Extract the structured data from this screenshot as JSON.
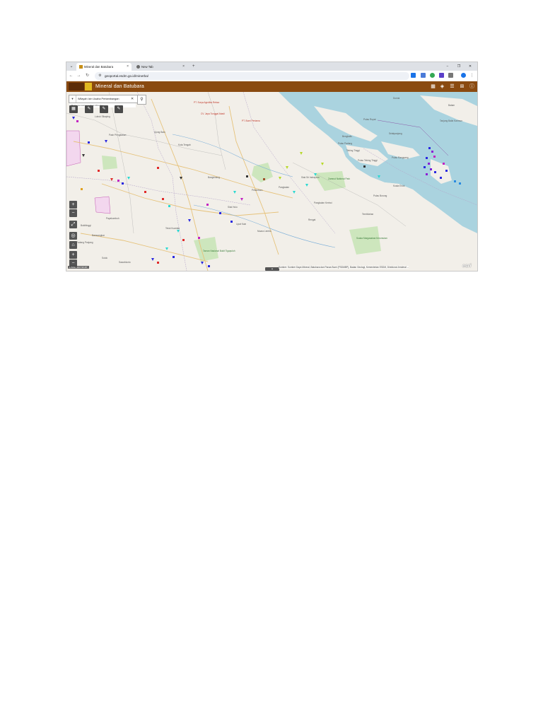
{
  "browser": {
    "tabs": [
      {
        "title": "Mineral dan Batubara"
      },
      {
        "title": "New Tab"
      }
    ],
    "new_tab_label": "+",
    "close_label": "×",
    "window_controls": {
      "minimize": "−",
      "restore": "❐",
      "close": "✕"
    },
    "url": "geoportal.esdm.go.id/minerba/"
  },
  "app": {
    "title": "Mineral dan Batubara",
    "header_icons": [
      "basemap-icon",
      "layers-icon",
      "legend-icon",
      "add-icon",
      "info-icon"
    ],
    "accent_color": "#8a4a10"
  },
  "search": {
    "value": "Wilayah Izin Usaha Pertambangan",
    "hint": "Batas pencarian terluas Minerba"
  },
  "map": {
    "coords": "1°6'51\" 101°34'45\"",
    "attribution": "Sumber: Sumber Daya Mineral, Batubara dan Panas Bumi (PSDMBP), Badan Geologi, Kementerian ESDM, Direktorat Jenderal ...",
    "esri": "esri",
    "labels": [
      {
        "text": "Dumai",
        "cls": ""
      },
      {
        "text": "Pulau Rupat",
        "cls": ""
      },
      {
        "text": "Bengkalis",
        "cls": ""
      },
      {
        "text": "Pulau Padang",
        "cls": ""
      },
      {
        "text": "Tebing Tinggi",
        "cls": ""
      },
      {
        "text": "Pulau Tebing Tinggi",
        "cls": ""
      },
      {
        "text": "Pulau Rangsang",
        "cls": ""
      },
      {
        "text": "Pekanbaru",
        "cls": ""
      },
      {
        "text": "Rengat",
        "cls": ""
      },
      {
        "text": "Siak Sri Indrapura",
        "cls": ""
      },
      {
        "text": "Kota Tengah",
        "cls": ""
      },
      {
        "text": "Pangkalan Kerinci",
        "cls": ""
      },
      {
        "text": "Bangkinang",
        "cls": ""
      },
      {
        "text": "Lipat Kain",
        "cls": ""
      },
      {
        "text": "Teluk Kuantan",
        "cls": ""
      },
      {
        "text": "Taman Nasional Bukit Tigapuluh",
        "cls": "green"
      },
      {
        "text": "Zamrud National Park",
        "cls": "green"
      },
      {
        "text": "Suaka Margasatwa Kerumutan",
        "cls": "green"
      },
      {
        "text": "PT. Surya Agrolika Reksa",
        "cls": "red"
      },
      {
        "text": "CV. Jaya Tunggal Abadi",
        "cls": "red"
      },
      {
        "text": "PT. Bumi Pertama",
        "cls": "red"
      },
      {
        "text": "Bukittinggi",
        "cls": ""
      },
      {
        "text": "Payakumbuh",
        "cls": ""
      },
      {
        "text": "Padang Panjang",
        "cls": ""
      },
      {
        "text": "Batusangkar",
        "cls": ""
      },
      {
        "text": "Solok",
        "cls": ""
      },
      {
        "text": "Sawahlunto",
        "cls": ""
      },
      {
        "text": "Tembilahan",
        "cls": ""
      },
      {
        "text": "Selatpanjang",
        "cls": ""
      },
      {
        "text": "Tanjung Balai Karimun",
        "cls": ""
      },
      {
        "text": "Batam",
        "cls": ""
      },
      {
        "text": "Lubuk Sikaping",
        "cls": ""
      },
      {
        "text": "Pasir Pengaraian",
        "cls": ""
      },
      {
        "text": "Ujung Batu",
        "cls": ""
      },
      {
        "text": "Pangkalan",
        "cls": ""
      },
      {
        "text": "Siak Hulu",
        "cls": ""
      },
      {
        "text": "Muara Lembu",
        "cls": ""
      },
      {
        "text": "Kuala Enok",
        "cls": ""
      },
      {
        "text": "Pulau Burung",
        "cls": ""
      }
    ]
  }
}
